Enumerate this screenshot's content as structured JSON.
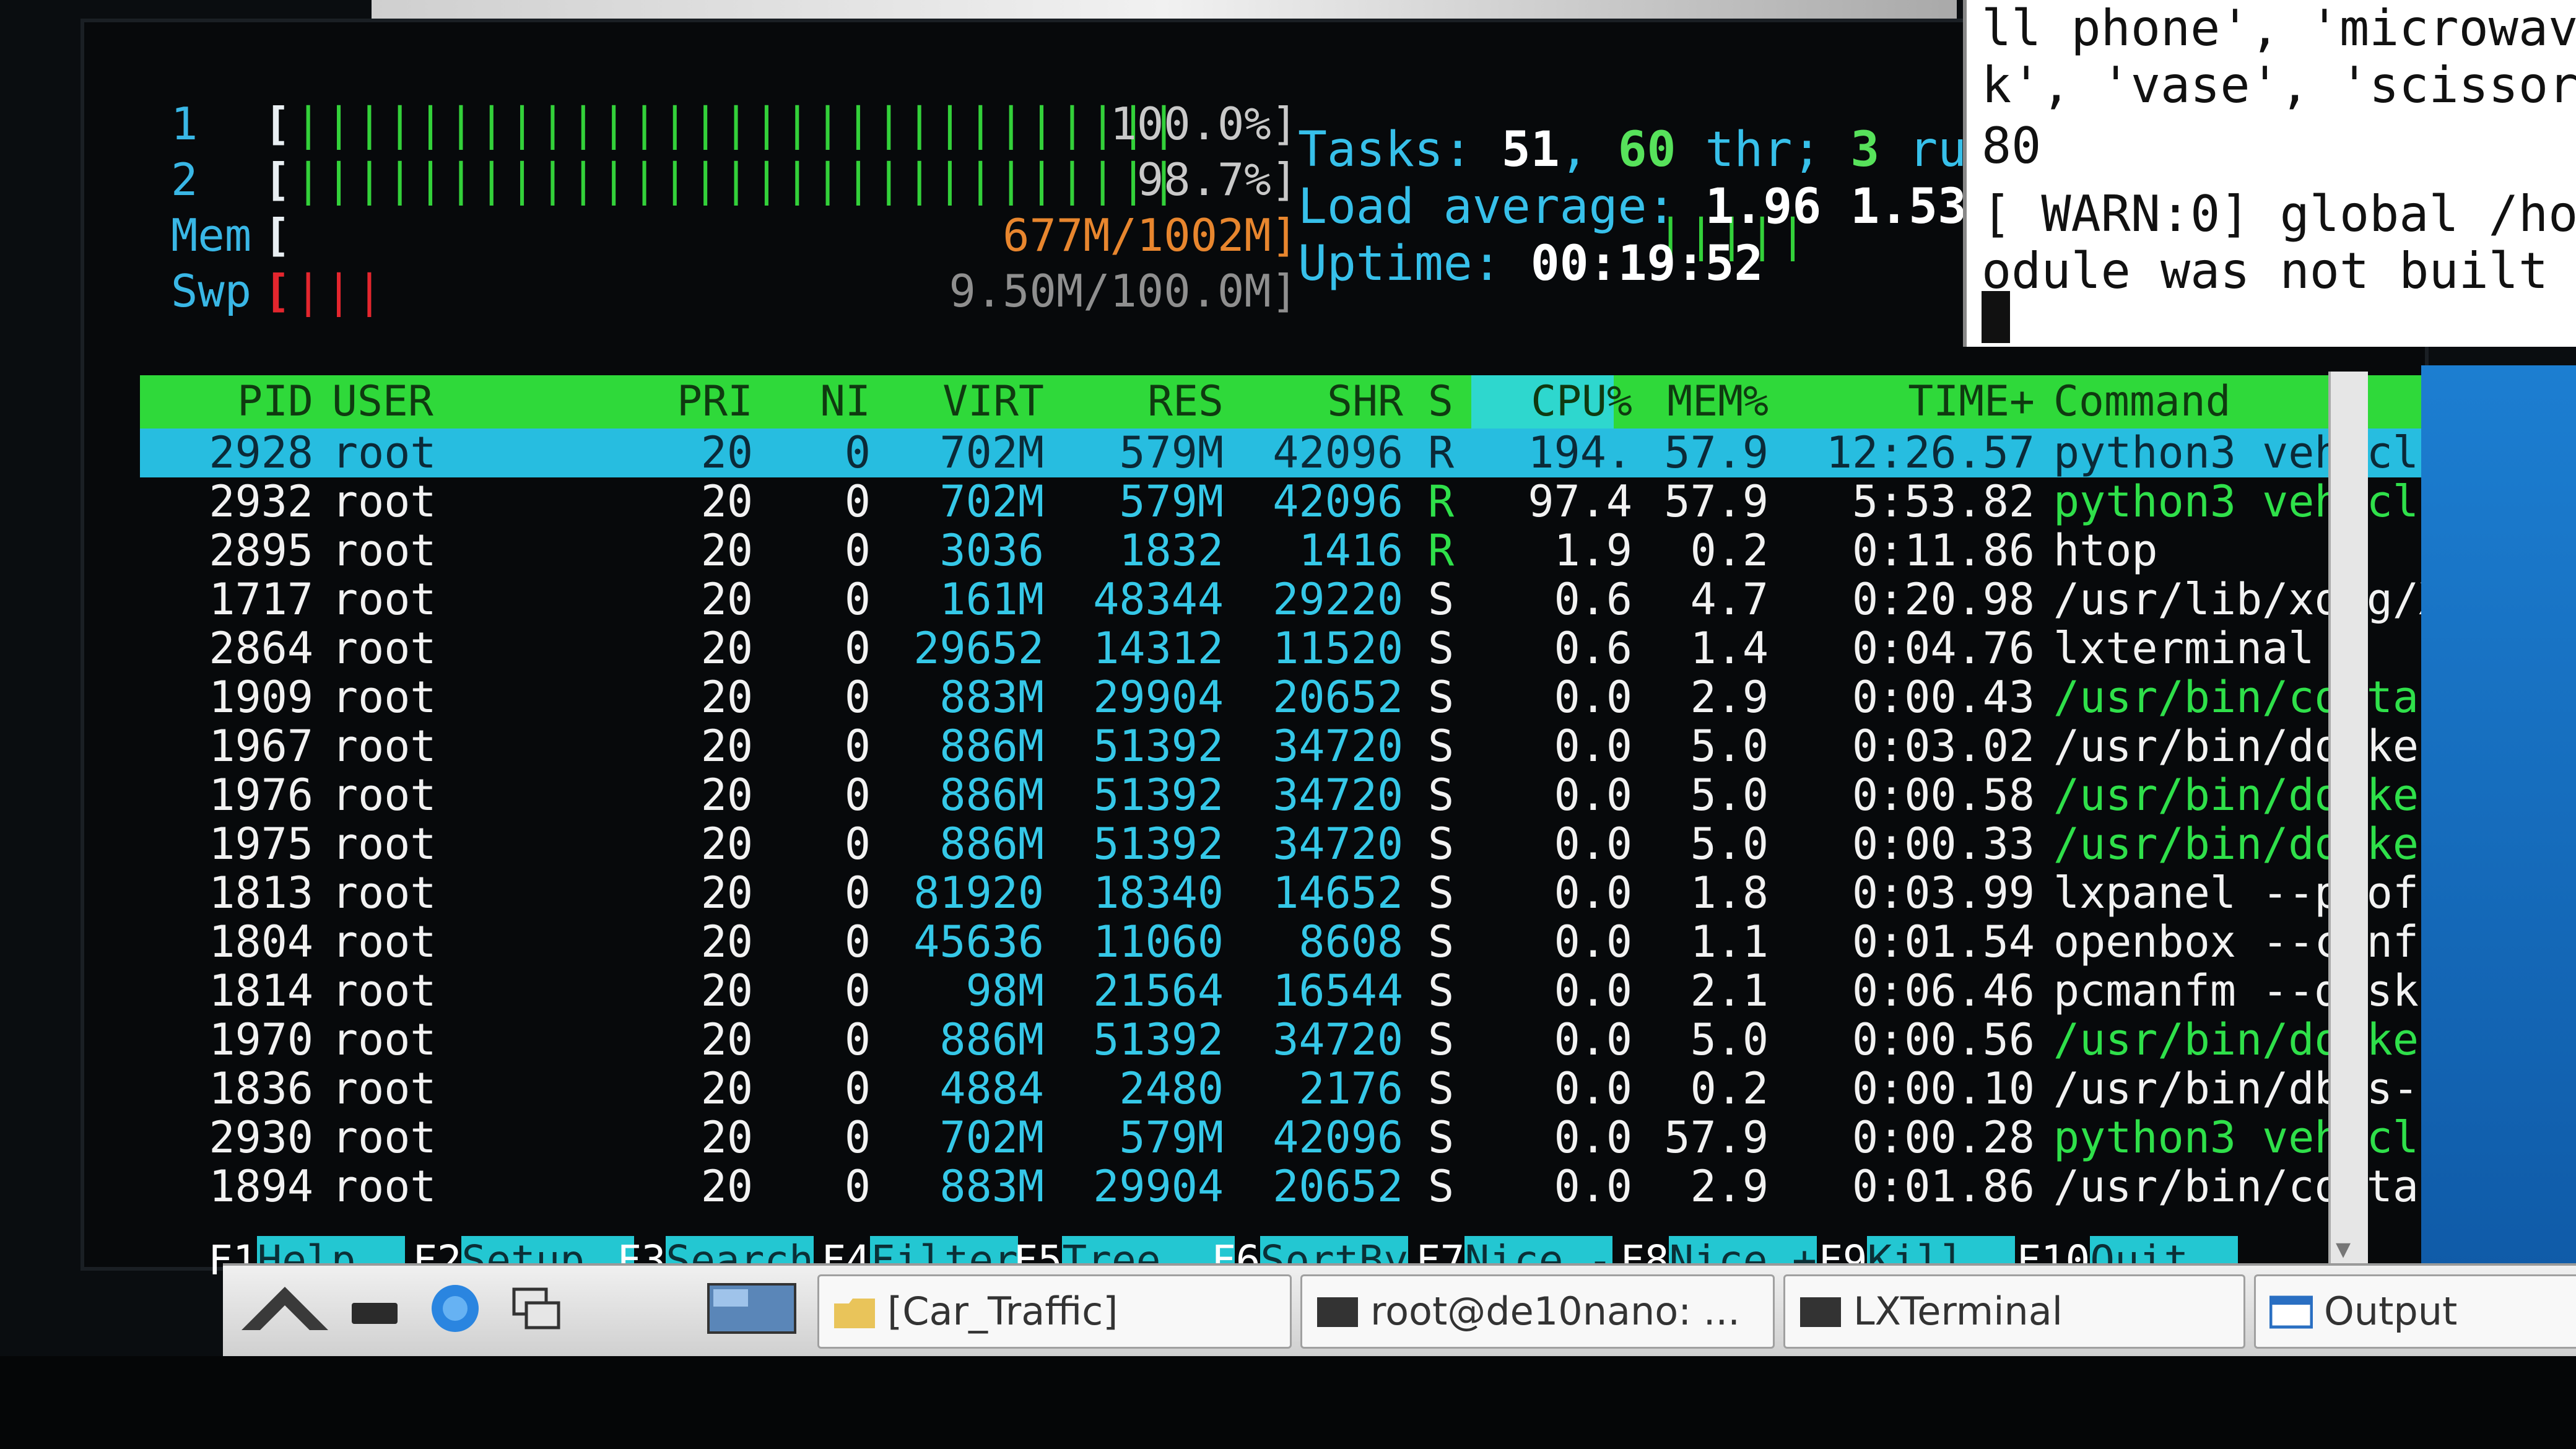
{
  "meters": {
    "cpu1": {
      "label": "1",
      "bar": "||||||||||||||||||||||||||||||||||||||||",
      "value": "100.0%]"
    },
    "cpu2": {
      "label": "2",
      "bar": "|||||||||||||||||||||||||||||||||||||||",
      "value": "98.7%]"
    },
    "mem": {
      "label": "Mem",
      "bar": "||||||||||||||||||||||||||||||||||||||",
      "value": "677M/1002M]"
    },
    "swp": {
      "label": "Swp",
      "bar": "|||",
      "value": "9.50M/100.0M]"
    },
    "open_bracket": "["
  },
  "summary": {
    "tasks_label": "Tasks: ",
    "tasks": "51",
    "thr": "60",
    "thr_label": " thr; ",
    "running": "3",
    "running_label": " ru",
    "load_label": "Load average: ",
    "load1": "1.96",
    "load5": "1.53",
    "uptime_label": "Uptime: ",
    "uptime": "00:19:52"
  },
  "table": {
    "headers": {
      "pid": "PID",
      "user": "USER",
      "pri": "PRI",
      "ni": "NI",
      "virt": "VIRT",
      "res": "RES",
      "shr": "SHR",
      "s": "S",
      "cpu": "CPU%",
      "mem": "MEM%",
      "time": "TIME+",
      "command": "Command"
    },
    "rows": [
      {
        "pid": "2928",
        "user": "root",
        "pri": "20",
        "ni": "0",
        "virt": "702M",
        "res": "579M",
        "shr": "42096",
        "s": "R",
        "cpu": "194.",
        "mem": "57.9",
        "time": "12:26.57",
        "command": "python3 vehicle_c"
      },
      {
        "pid": "2932",
        "user": "root",
        "pri": "20",
        "ni": "0",
        "virt": "702M",
        "res": "579M",
        "shr": "42096",
        "s": "R",
        "cpu": "97.4",
        "mem": "57.9",
        "time": "5:53.82",
        "command": "python3 vehicle_c"
      },
      {
        "pid": "2895",
        "user": "root",
        "pri": "20",
        "ni": "0",
        "virt": "3036",
        "res": "1832",
        "shr": "1416",
        "s": "R",
        "cpu": "1.9",
        "mem": "0.2",
        "time": "0:11.86",
        "command": "htop"
      },
      {
        "pid": "1717",
        "user": "root",
        "pri": "20",
        "ni": "0",
        "virt": "161M",
        "res": "48344",
        "shr": "29220",
        "s": "S",
        "cpu": "0.6",
        "mem": "4.7",
        "time": "0:20.98",
        "command": "/usr/lib/xorg/Xor"
      },
      {
        "pid": "2864",
        "user": "root",
        "pri": "20",
        "ni": "0",
        "virt": "29652",
        "res": "14312",
        "shr": "11520",
        "s": "S",
        "cpu": "0.6",
        "mem": "1.4",
        "time": "0:04.76",
        "command": "lxterminal"
      },
      {
        "pid": "1909",
        "user": "root",
        "pri": "20",
        "ni": "0",
        "virt": "883M",
        "res": "29904",
        "shr": "20652",
        "s": "S",
        "cpu": "0.0",
        "mem": "2.9",
        "time": "0:00.43",
        "command": "/usr/bin/containe"
      },
      {
        "pid": "1967",
        "user": "root",
        "pri": "20",
        "ni": "0",
        "virt": "886M",
        "res": "51392",
        "shr": "34720",
        "s": "S",
        "cpu": "0.0",
        "mem": "5.0",
        "time": "0:03.02",
        "command": "/usr/bin/dockerd"
      },
      {
        "pid": "1976",
        "user": "root",
        "pri": "20",
        "ni": "0",
        "virt": "886M",
        "res": "51392",
        "shr": "34720",
        "s": "S",
        "cpu": "0.0",
        "mem": "5.0",
        "time": "0:00.58",
        "command": "/usr/bin/dockerd"
      },
      {
        "pid": "1975",
        "user": "root",
        "pri": "20",
        "ni": "0",
        "virt": "886M",
        "res": "51392",
        "shr": "34720",
        "s": "S",
        "cpu": "0.0",
        "mem": "5.0",
        "time": "0:00.33",
        "command": "/usr/bin/dockerd"
      },
      {
        "pid": "1813",
        "user": "root",
        "pri": "20",
        "ni": "0",
        "virt": "81920",
        "res": "18340",
        "shr": "14652",
        "s": "S",
        "cpu": "0.0",
        "mem": "1.8",
        "time": "0:03.99",
        "command": "lxpanel --profile"
      },
      {
        "pid": "1804",
        "user": "root",
        "pri": "20",
        "ni": "0",
        "virt": "45636",
        "res": "11060",
        "shr": "8608",
        "s": "S",
        "cpu": "0.0",
        "mem": "1.1",
        "time": "0:01.54",
        "command": "openbox --config-"
      },
      {
        "pid": "1814",
        "user": "root",
        "pri": "20",
        "ni": "0",
        "virt": "98M",
        "res": "21564",
        "shr": "16544",
        "s": "S",
        "cpu": "0.0",
        "mem": "2.1",
        "time": "0:06.46",
        "command": "pcmanfm --desktop"
      },
      {
        "pid": "1970",
        "user": "root",
        "pri": "20",
        "ni": "0",
        "virt": "886M",
        "res": "51392",
        "shr": "34720",
        "s": "S",
        "cpu": "0.0",
        "mem": "5.0",
        "time": "0:00.56",
        "command": "/usr/bin/dockerd"
      },
      {
        "pid": "1836",
        "user": "root",
        "pri": "20",
        "ni": "0",
        "virt": "4884",
        "res": "2480",
        "shr": "2176",
        "s": "S",
        "cpu": "0.0",
        "mem": "0.2",
        "time": "0:00.10",
        "command": "/usr/bin/dbus-dae"
      },
      {
        "pid": "2930",
        "user": "root",
        "pri": "20",
        "ni": "0",
        "virt": "702M",
        "res": "579M",
        "shr": "42096",
        "s": "S",
        "cpu": "0.0",
        "mem": "57.9",
        "time": "0:00.28",
        "command": "python3 vehicle_c"
      },
      {
        "pid": "1894",
        "user": "root",
        "pri": "20",
        "ni": "0",
        "virt": "883M",
        "res": "29904",
        "shr": "20652",
        "s": "S",
        "cpu": "0.0",
        "mem": "2.9",
        "time": "0:01.86",
        "command": "/usr/bin/containe"
      }
    ]
  },
  "fkeys": [
    {
      "key": "F1",
      "label": "Help  "
    },
    {
      "key": "F2",
      "label": "Setup  "
    },
    {
      "key": "F3",
      "label": "Search"
    },
    {
      "key": "F4",
      "label": "Filter"
    },
    {
      "key": "F5",
      "label": "Tree   "
    },
    {
      "key": "F6",
      "label": "SortBy"
    },
    {
      "key": "F7",
      "label": "Nice -"
    },
    {
      "key": "F8",
      "label": "Nice +"
    },
    {
      "key": "F9",
      "label": "Kill  "
    },
    {
      "key": "F10",
      "label": "Quit  "
    }
  ],
  "term2": {
    "lines": [
      "ll phone', 'microwav",
      "k', 'vase', 'scissors",
      "80",
      "[ WARN:0] global /hom",
      "odule was not built wi"
    ]
  },
  "taskbar": {
    "items": [
      {
        "label": "[Car_Traffic]"
      },
      {
        "label": "root@de10nano: ..."
      },
      {
        "label": "LXTerminal"
      },
      {
        "label": "Output"
      }
    ]
  },
  "colors": {
    "bar_green": "#33d13a",
    "header_green": "#2fd93a",
    "cyan": "#27bde0",
    "red": "#e4262e"
  }
}
